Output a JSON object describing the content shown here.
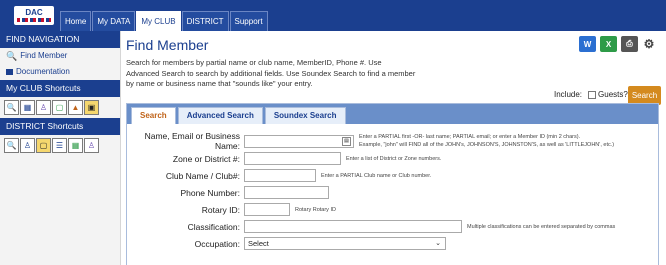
{
  "logo": {
    "text": "DAC"
  },
  "nav": {
    "tabs": [
      {
        "label": "Home"
      },
      {
        "label": "My DATA"
      },
      {
        "label": "My CLUB"
      },
      {
        "label": "DISTRICT"
      },
      {
        "label": "Support"
      }
    ],
    "active": "My CLUB"
  },
  "sidebar": {
    "find_navigation": "FIND NAVIGATION",
    "find_member": "Find Member",
    "documentation": "Documentation",
    "club_shortcuts": "My CLUB Shortcuts",
    "district_shortcuts": "DISTRICT Shortcuts"
  },
  "page": {
    "title": "Find Member",
    "intro": "Search for members by partial name or club name, MemberID, Phone #. Use Advanced Search to search by additional fields. Use Soundex Search to find a member by name or business name that \"sounds like\" your entry.",
    "include_label": "Include:",
    "guests_label": "Guests?",
    "search_button": "Search"
  },
  "tools": {
    "word_icon": "W",
    "excel_icon": "X",
    "print_icon": "⎙",
    "settings_icon": "⚙"
  },
  "tabs": [
    {
      "label": "Search"
    },
    {
      "label": "Advanced Search"
    },
    {
      "label": "Soundex Search"
    }
  ],
  "form": {
    "name_label": "Name, Email or Business Name:",
    "name_hint_1": "Enter a PARTIAL first -OR- last name; PARTIAL email; or enter a Member ID (min 2 chars).",
    "name_hint_2": "Example, \"john\" will FIND all of the JOHN's, JOHNSON'S, JOHNSTON'S, as well as 'LITTLEJOHN', etc.)",
    "zone_label": "Zone or District #:",
    "zone_hint": "Enter a list of District or Zone numbers.",
    "club_label": "Club Name / Club#:",
    "club_hint": "Enter a PARTIAL Club name or Club number.",
    "phone_label": "Phone Number:",
    "rotary_label": "Rotary ID:",
    "rotary_hint": "Rotary Rotary ID",
    "classification_label": "Classification:",
    "classification_hint": "Multiple classifications can be entered separated by commas",
    "occupation_label": "Occupation:",
    "occupation_value": "Select"
  }
}
